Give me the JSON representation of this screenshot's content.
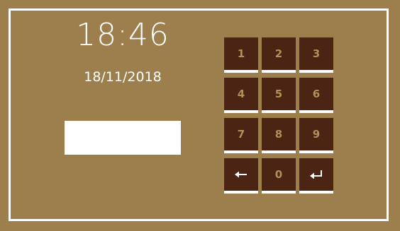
{
  "clock": {
    "time": "18:46",
    "date": "18/11/2018"
  },
  "code_field": {
    "value": "",
    "placeholder": ""
  },
  "keypad": {
    "keys": [
      {
        "label": "1",
        "name": "key-1-button"
      },
      {
        "label": "2",
        "name": "key-2-button"
      },
      {
        "label": "3",
        "name": "key-3-button"
      },
      {
        "label": "4",
        "name": "key-4-button"
      },
      {
        "label": "5",
        "name": "key-5-button"
      },
      {
        "label": "6",
        "name": "key-6-button"
      },
      {
        "label": "7",
        "name": "key-7-button"
      },
      {
        "label": "8",
        "name": "key-8-button"
      },
      {
        "label": "9",
        "name": "key-9-button"
      },
      {
        "icon": "backspace-arrow-icon",
        "name": "backspace-button"
      },
      {
        "label": "0",
        "name": "key-0-button"
      },
      {
        "icon": "enter-return-icon",
        "name": "enter-button"
      }
    ]
  },
  "colors": {
    "background": "#9c7f4c",
    "key_background": "#4b2414",
    "key_digit": "#b58e58",
    "accent": "#ffffff"
  }
}
